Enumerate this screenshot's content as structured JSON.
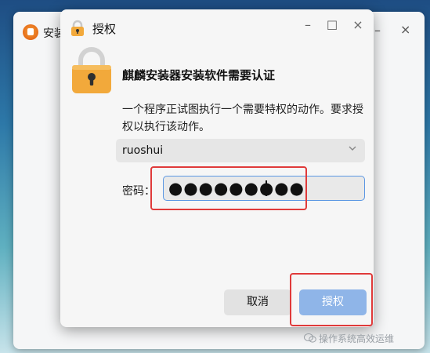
{
  "background_window": {
    "title": "安装",
    "minimize": "–",
    "close": "×"
  },
  "dialog": {
    "title": "授权",
    "minimize": "–",
    "maximize": "☐",
    "close": "×",
    "heading": "麒麟安装器安装软件需要认证",
    "description": "一个程序正试图执行一个需要特权的动作。要求授权以执行该动作。",
    "user": {
      "selected": "ruoshui"
    },
    "password": {
      "label": "密码：",
      "value": "●●●●●●●●●"
    },
    "buttons": {
      "cancel": "取消",
      "authorize": "授权"
    }
  },
  "watermark": "操作系统高效运维",
  "colors": {
    "lock_body": "#f2a93b",
    "highlight": "#e03a3a",
    "authorize_button": "#8fb5e8",
    "focus_border": "#5b97e3"
  },
  "icons": {
    "dialog_title": "lock-icon",
    "dialog_body": "lock-icon",
    "dropdown": "chevron-down-icon",
    "app": "kylin-installer-logo"
  }
}
